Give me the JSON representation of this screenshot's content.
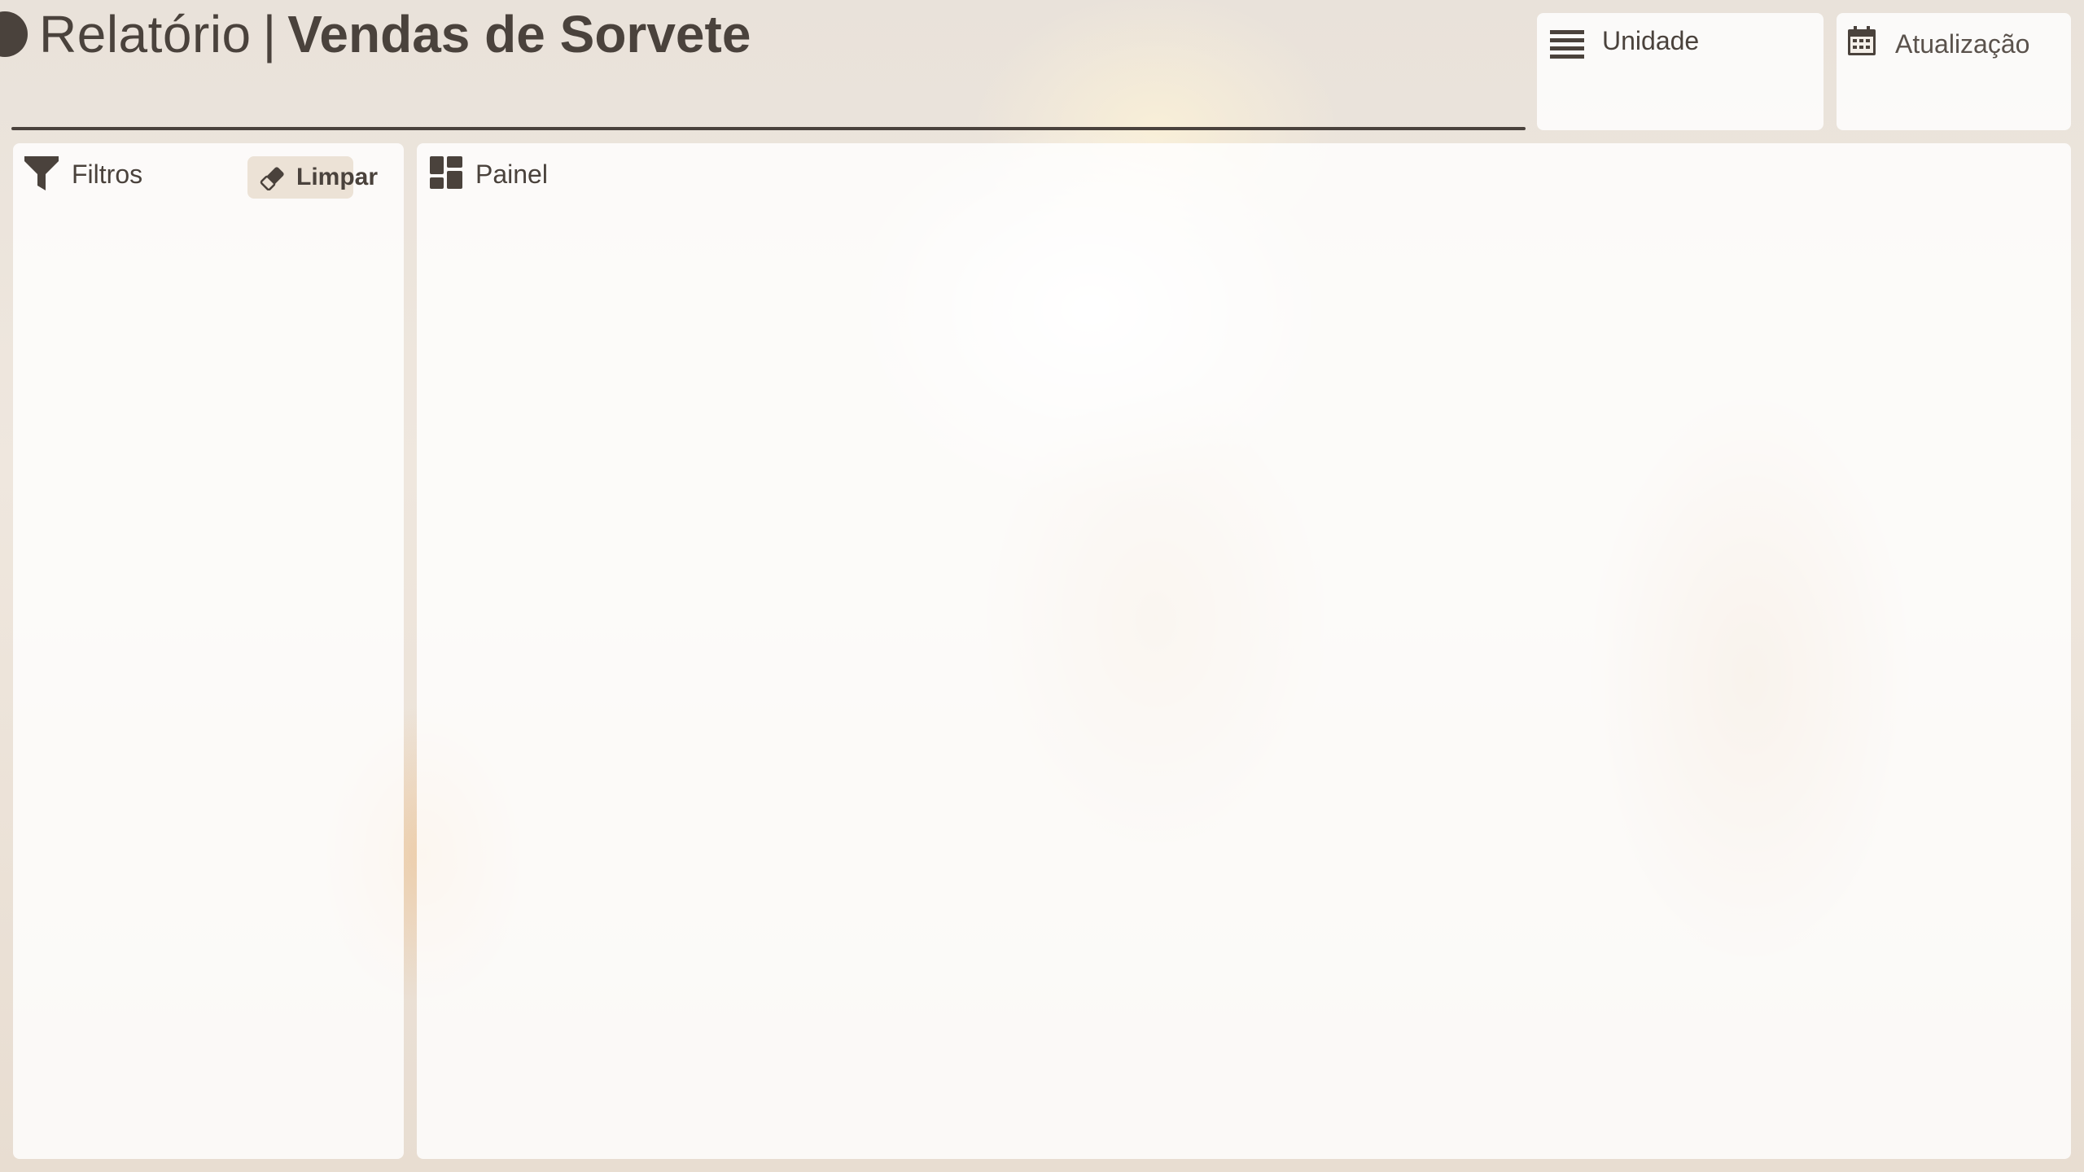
{
  "header": {
    "title_prefix": "Relatório",
    "title_separator": "|",
    "title_main": "Vendas de Sorvete"
  },
  "cards": {
    "unidade": {
      "label": "Unidade",
      "icon": "list-lines-icon"
    },
    "atualizacao": {
      "label": "Atualização",
      "icon": "calendar-icon"
    }
  },
  "filters": {
    "label": "Filtros",
    "icon": "funnel-icon",
    "clear_button": {
      "label": "Limpar",
      "icon": "eraser-icon"
    }
  },
  "dashboard": {
    "label": "Painel",
    "icon": "dashboard-grid-icon"
  },
  "colors": {
    "text": "#4a423c",
    "panel": "#ffffff",
    "button_bg": "#ece2d6"
  }
}
